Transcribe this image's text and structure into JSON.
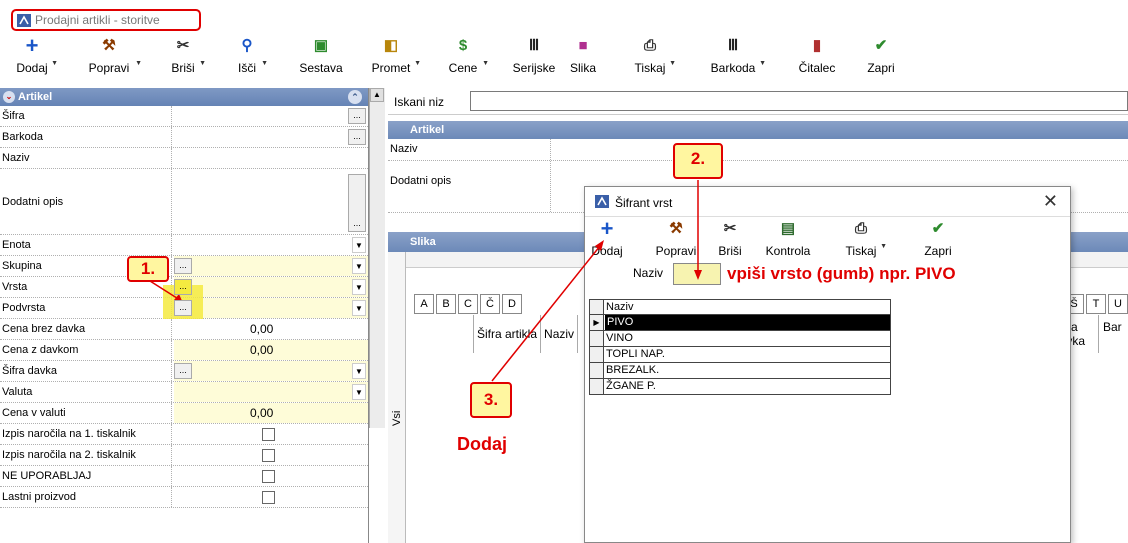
{
  "window": {
    "title": "Prodajni artikli - storitve"
  },
  "toolbar": {
    "buttons": [
      {
        "label": "Dodaj",
        "icon": "+",
        "color": "#1a56c8"
      },
      {
        "label": "Popravi",
        "icon": "⚒",
        "color": "#8a3a00"
      },
      {
        "label": "Briši",
        "icon": "✂",
        "color": "#333333"
      },
      {
        "label": "Išči",
        "icon": "⚲",
        "color": "#1a56c8"
      },
      {
        "label": "Sestava",
        "icon": "▣",
        "color": "#2e8b2e"
      },
      {
        "label": "Promet",
        "icon": "◧",
        "color": "#b8860b"
      },
      {
        "label": "Cene",
        "icon": "$",
        "color": "#2e8b2e"
      },
      {
        "label": "Serijske",
        "icon": "Ⅲ",
        "color": "#222222"
      },
      {
        "label": "Slika",
        "icon": "■",
        "color": "#b03090"
      },
      {
        "label": "Tiskaj",
        "icon": "⎙",
        "color": "#333333"
      },
      {
        "label": "Barkoda",
        "icon": "Ⅲ",
        "color": "#222222"
      },
      {
        "label": "Čitalec",
        "icon": "▮",
        "color": "#b03030"
      },
      {
        "label": "Zapri",
        "icon": "✔",
        "color": "#2e8b2e"
      }
    ]
  },
  "left_panel": {
    "header": "Artikel",
    "rows": [
      {
        "label": "Šifra"
      },
      {
        "label": "Barkoda"
      },
      {
        "label": "Naziv"
      },
      {
        "label": "Dodatni opis"
      },
      {
        "label": "Enota"
      },
      {
        "label": "Skupina"
      },
      {
        "label": "Vrsta"
      },
      {
        "label": "Podvrsta"
      },
      {
        "label": "Cena brez davka",
        "value": "0,00"
      },
      {
        "label": "Cena z davkom",
        "value": "0,00"
      },
      {
        "label": "Šifra davka"
      },
      {
        "label": "Valuta"
      },
      {
        "label": "Cena v valuti",
        "value": "0,00"
      },
      {
        "label": "Izpis naročila na 1. tiskalnik"
      },
      {
        "label": "Izpis naročila na 2. tiskalnik"
      },
      {
        "label": "NE UPORABLJAJ"
      },
      {
        "label": "Lastni proizvod"
      }
    ]
  },
  "right_panel": {
    "search_label": "Iskani niz",
    "artikel_header": "Artikel",
    "naziv_label": "Naziv",
    "dodatni_opis_label": "Dodatni opis",
    "slika_header": "Slika",
    "vsi_label": "Vsi",
    "letters_left": [
      "A",
      "B",
      "C",
      "Č",
      "D"
    ],
    "letters_right": [
      "Š",
      "T",
      "U"
    ],
    "col_sifra_artikla": "Šifra artikla",
    "col_naziv": "Naziv",
    "col_sifra_davka": "Šifra davka",
    "col_bar": "Bar"
  },
  "dialog": {
    "title": "Šifrant vrst",
    "buttons": [
      {
        "label": "Dodaj",
        "icon": "+",
        "color": "#1a56c8"
      },
      {
        "label": "Popravi",
        "icon": "⚒",
        "color": "#8a3a00"
      },
      {
        "label": "Briši",
        "icon": "✂",
        "color": "#333333"
      },
      {
        "label": "Kontrola",
        "icon": "▤",
        "color": "#2e6b2e"
      },
      {
        "label": "Tiskaj",
        "icon": "⎙",
        "color": "#333333"
      },
      {
        "label": "Zapri",
        "icon": "✔",
        "color": "#2e8b2e"
      }
    ],
    "naziv_label": "Naziv",
    "hint": "vpiši vrsto (gumb)  npr. PIVO",
    "grid_header": "Naziv",
    "items": [
      "PIVO",
      "VINO",
      "TOPLI NAP.",
      "BREZALK.",
      "ŽGANE P."
    ],
    "selected_index": 0
  },
  "annotations": {
    "step1": "1.",
    "step2": "2.",
    "step3": "3.",
    "step3_caption": "Dodaj"
  }
}
